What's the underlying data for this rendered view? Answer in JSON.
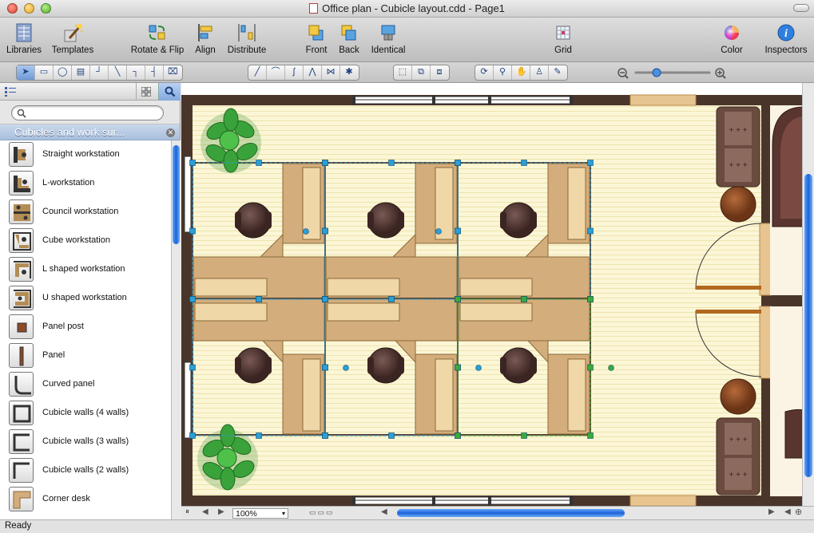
{
  "window": {
    "title": "Office plan - Cubicle layout.cdd - Page1"
  },
  "toolbar": {
    "items": [
      {
        "label": "Libraries",
        "icon": "libraries-icon"
      },
      {
        "label": "Templates",
        "icon": "templates-icon"
      },
      {
        "label": "Rotate & Flip",
        "icon": "rotate-flip-icon"
      },
      {
        "label": "Align",
        "icon": "align-icon"
      },
      {
        "label": "Distribute",
        "icon": "distribute-icon"
      },
      {
        "label": "Front",
        "icon": "front-icon"
      },
      {
        "label": "Back",
        "icon": "back-icon"
      },
      {
        "label": "Identical",
        "icon": "identical-icon"
      },
      {
        "label": "Grid",
        "icon": "grid-icon"
      },
      {
        "label": "Color",
        "icon": "color-icon"
      },
      {
        "label": "Inspectors",
        "icon": "inspectors-icon"
      }
    ]
  },
  "sidebar": {
    "search_placeholder": "",
    "library_title": "Cubicles and work sur...",
    "shapes": [
      "Straight workstation",
      "L-workstation",
      "Council workstation",
      "Cube workstation",
      "L shaped workstation",
      "U shaped workstation",
      "Panel post",
      "Panel",
      "Curved panel",
      "Cubicle walls (4 walls)",
      "Cubicle walls (3 walls)",
      "Cubicle walls (2 walls)",
      "Corner desk"
    ]
  },
  "canvas": {
    "zoom": "100%"
  },
  "status": {
    "text": "Ready"
  },
  "colors": {
    "floor": "#fbf6d6",
    "wall": "#4a352b",
    "desk": "#d3ad7b",
    "selection": "#2b9fd6",
    "plant": "#3aa23a"
  }
}
